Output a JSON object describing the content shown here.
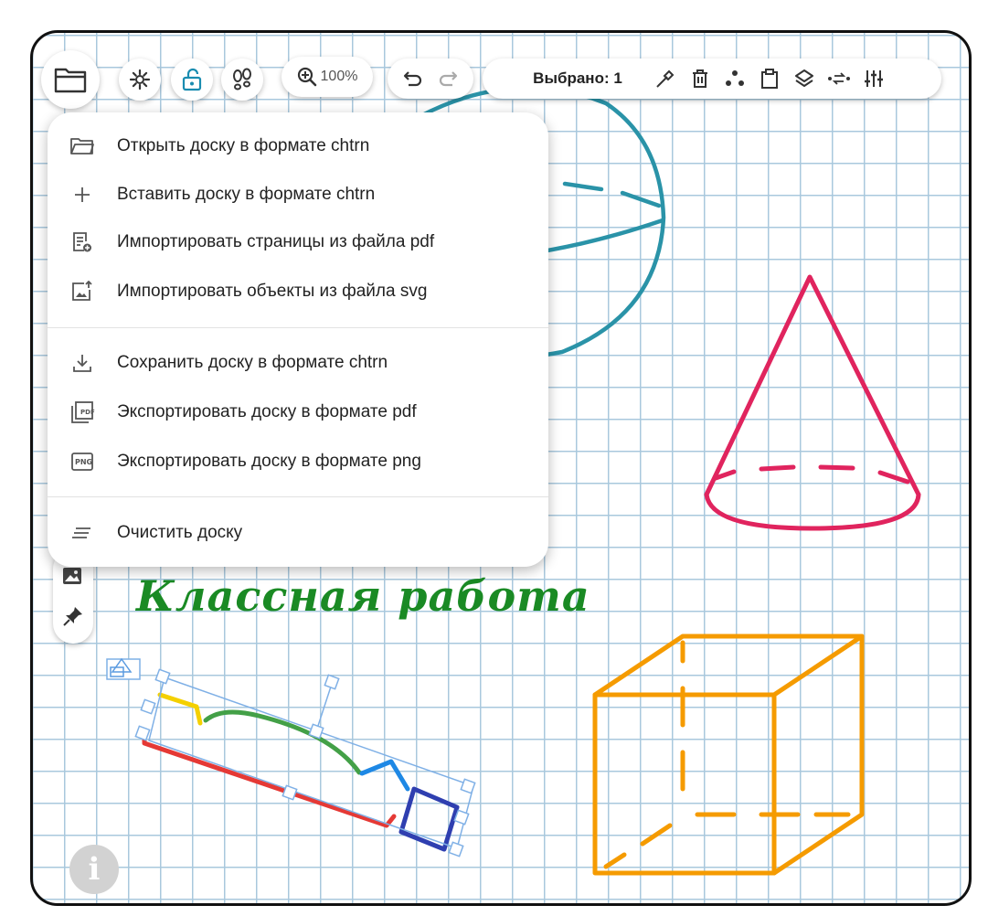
{
  "toolbar": {
    "zoom_label": "100%",
    "selection_label": "Выбрано: 1",
    "icons": [
      "folder-icon",
      "gear-icon",
      "unlock-icon",
      "footprints-icon",
      "zoom-in-icon",
      "undo-icon",
      "redo-icon",
      "color-picker-icon",
      "trash-icon",
      "points-icon",
      "clipboard-icon",
      "layers-icon",
      "arrow-swap-icon",
      "sliders-icon"
    ]
  },
  "file_menu": {
    "items": [
      {
        "label": "Открыть доску в формате chtrn",
        "icon": "folder-open-icon"
      },
      {
        "label": "Вставить доску в формате chtrn",
        "icon": "plus-icon"
      },
      {
        "label": "Импортировать страницы из файла pdf",
        "icon": "document-add-icon"
      },
      {
        "label": "Импортировать объекты из файла svg",
        "icon": "image-upload-icon"
      },
      {
        "label": "Сохранить доску в формате chtrn",
        "icon": "download-icon"
      },
      {
        "label": "Экспортировать доску в формате pdf",
        "icon": "pdf-icon",
        "badge": "PDF"
      },
      {
        "label": "Экспортировать доску в формате png",
        "icon": "png-icon",
        "badge": "PNG"
      },
      {
        "label": "Очистить доску",
        "icon": "clear-icon"
      }
    ]
  },
  "board": {
    "handwritten_title": "Классная работа",
    "info_icon": "i"
  },
  "colors": {
    "sphere": "#2a93a8",
    "cone": "#e0245e",
    "cube": "#f59b00",
    "title": "#1a8a24",
    "grid": "#a9c8dd",
    "selection": "#7fb0e6"
  }
}
